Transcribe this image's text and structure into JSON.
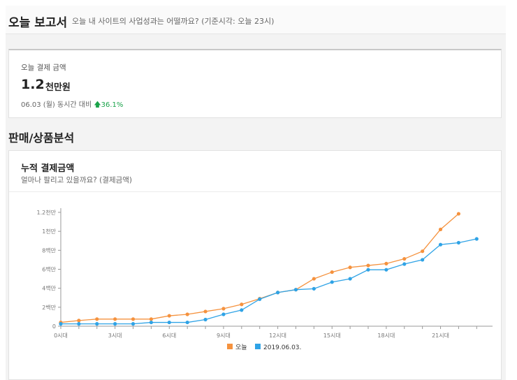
{
  "header": {
    "title": "오늘 보고서",
    "subtitle": "오늘 내 사이트의 사업성과는 어떨까요? (기준시각: 오늘 23시)"
  },
  "summary": {
    "label": "오늘 결제 금액",
    "amount": "1.2",
    "unit": "천만원",
    "compare_text": "06.03 (월) 동시간 대비",
    "change_icon": "arrow-up-icon",
    "change_value": "36.1%",
    "change_color": "#1aa34a"
  },
  "section": {
    "title": "판매/상품분석"
  },
  "chart_card": {
    "title": "누적 결제금액",
    "subtitle": "얼마나 팔리고 있을까요? (결제금액)"
  },
  "chart_data": {
    "type": "line",
    "x": [
      0,
      1,
      2,
      3,
      4,
      5,
      6,
      7,
      8,
      9,
      10,
      11,
      12,
      13,
      14,
      15,
      16,
      17,
      18,
      19,
      20,
      21,
      22,
      23
    ],
    "x_tick_labels": [
      "0시대",
      "3시대",
      "6시대",
      "9시대",
      "12시대",
      "15시대",
      "18시대",
      "21시대"
    ],
    "x_tick_positions": [
      0,
      3,
      6,
      9,
      12,
      15,
      18,
      21
    ],
    "y_tick_labels": [
      "0",
      "2백만",
      "4백만",
      "6백만",
      "8백만",
      "1천만",
      "1.2천만"
    ],
    "y_tick_values": [
      0,
      2000000,
      4000000,
      6000000,
      8000000,
      10000000,
      12000000
    ],
    "ylim": [
      0,
      12000000
    ],
    "series": [
      {
        "name": "오늘",
        "color": "#f5923e",
        "values": [
          400000,
          600000,
          750000,
          750000,
          750000,
          750000,
          1100000,
          1250000,
          1550000,
          1850000,
          2300000,
          2900000,
          3550000,
          3850000,
          5000000,
          5700000,
          6200000,
          6400000,
          6600000,
          7100000,
          7900000,
          10200000,
          11850000,
          null
        ]
      },
      {
        "name": "2019.06.03.",
        "color": "#2fa3e6",
        "values": [
          250000,
          250000,
          250000,
          250000,
          250000,
          400000,
          400000,
          400000,
          700000,
          1250000,
          1700000,
          2850000,
          3550000,
          3850000,
          3950000,
          4650000,
          5000000,
          5950000,
          5950000,
          6550000,
          7000000,
          8600000,
          8800000,
          9200000
        ]
      }
    ],
    "legend_position": "bottom"
  }
}
